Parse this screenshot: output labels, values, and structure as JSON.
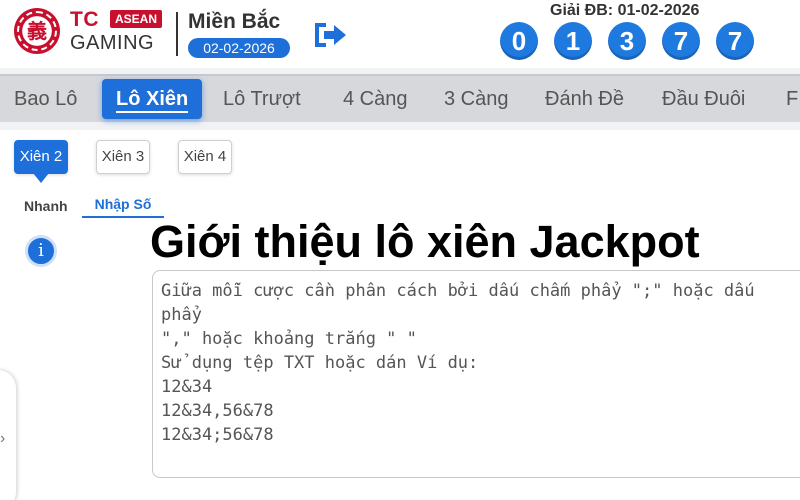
{
  "header": {
    "logo": {
      "brand_short": "TC",
      "badge": "ASEAN",
      "brand_name": "GAMING",
      "emblem_glyph": "義"
    },
    "region": {
      "title": "Miền Bắc",
      "date": "02-02-2026"
    },
    "logout_icon": "logout-arrow-icon",
    "jackpot": {
      "label": "Giải ĐB: 01-02-2026",
      "digits": [
        "0",
        "1",
        "3",
        "7",
        "7"
      ]
    },
    "colors": {
      "brand_red": "#c8102e",
      "accent_blue": "#1e6fd9",
      "ball_blue": "#1f7ae0"
    }
  },
  "nav": {
    "tabs": [
      {
        "label": "Bao Lô",
        "active": false
      },
      {
        "label": "Lô Xiên",
        "active": true
      },
      {
        "label": "Lô Trượt",
        "active": false
      },
      {
        "label": "4 Càng",
        "active": false
      },
      {
        "label": "3 Càng",
        "active": false
      },
      {
        "label": "Đánh Đề",
        "active": false
      },
      {
        "label": "Đầu Đuôi",
        "active": false
      },
      {
        "label": "F",
        "active": false
      }
    ]
  },
  "sub_tabs": [
    {
      "label": "Xiên 2",
      "active": true
    },
    {
      "label": "Xiên 3",
      "active": false
    },
    {
      "label": "Xiên 4",
      "active": false
    }
  ],
  "modes": {
    "quick": "Nhanh",
    "enter_numbers": "Nhập Số",
    "selected": "Nhập Số"
  },
  "overlay_title": "Giới thiệu lô xiên Jackpot",
  "input": {
    "placeholder_lines": [
      "Giữa mỗi cược cần phân cách bởi dấu chấm phẩy \";\" hoặc dấu",
      "phẩy",
      "\",\" hoặc khoảng trắng \" \"",
      "Sử dụng tệp TXT hoặc dán Ví dụ:",
      "12&34",
      "12&34,56&78",
      "12&34;56&78"
    ]
  },
  "icons": {
    "info": "info-icon",
    "side_handle": "chevron-right-icon"
  }
}
